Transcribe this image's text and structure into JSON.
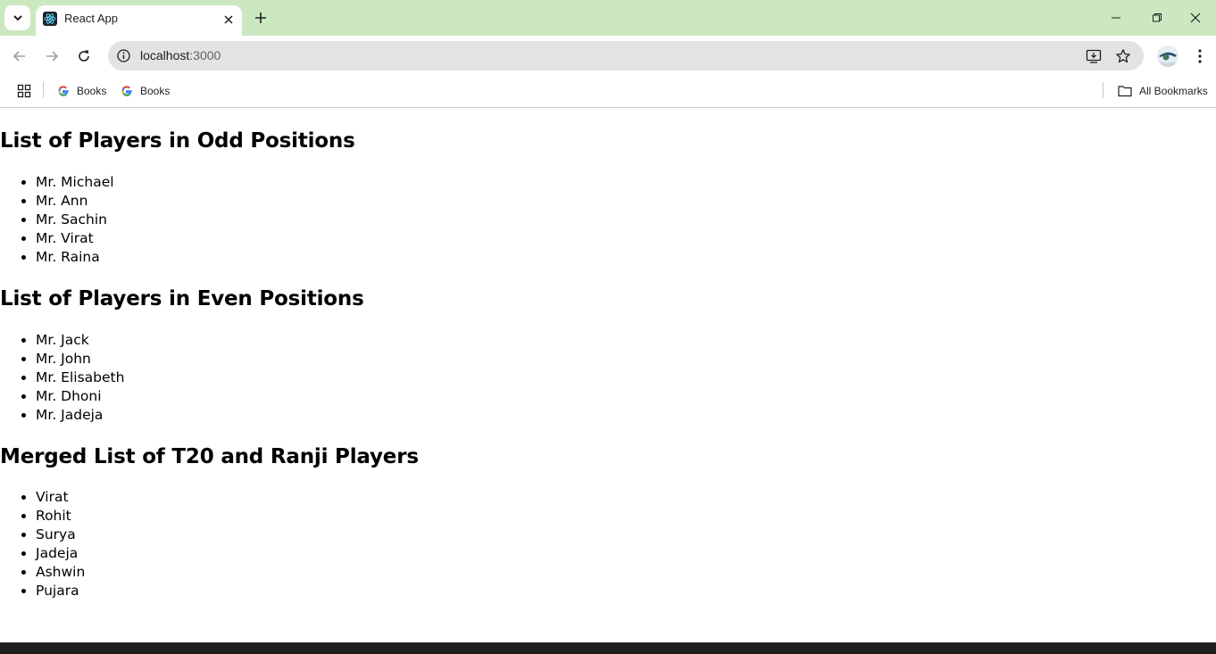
{
  "browser": {
    "tab": {
      "title": "React App",
      "favicon": "react-logo-icon"
    },
    "address": {
      "host": "localhost",
      "port": ":3000"
    },
    "bookmarks": [
      {
        "label": "Books",
        "icon": "google-g-icon"
      },
      {
        "label": "Books",
        "icon": "google-g-icon"
      }
    ],
    "all_bookmarks_label": "All Bookmarks",
    "colors": {
      "tabstrip": "#cbe8c0",
      "omnibox": "#e3e3e3"
    }
  },
  "page": {
    "sections": [
      {
        "title": "List of Players in Odd Positions",
        "items": [
          "Mr. Michael",
          "Mr. Ann",
          "Mr. Sachin",
          "Mr. Virat",
          "Mr. Raina"
        ]
      },
      {
        "title": "List of Players in Even Positions",
        "items": [
          "Mr. Jack",
          "Mr. John",
          "Mr. Elisabeth",
          "Mr. Dhoni",
          "Mr. Jadeja"
        ]
      },
      {
        "title": "Merged List of T20 and Ranji Players",
        "items": [
          "Virat",
          "Rohit",
          "Surya",
          "Jadeja",
          "Ashwin",
          "Pujara"
        ]
      }
    ]
  }
}
